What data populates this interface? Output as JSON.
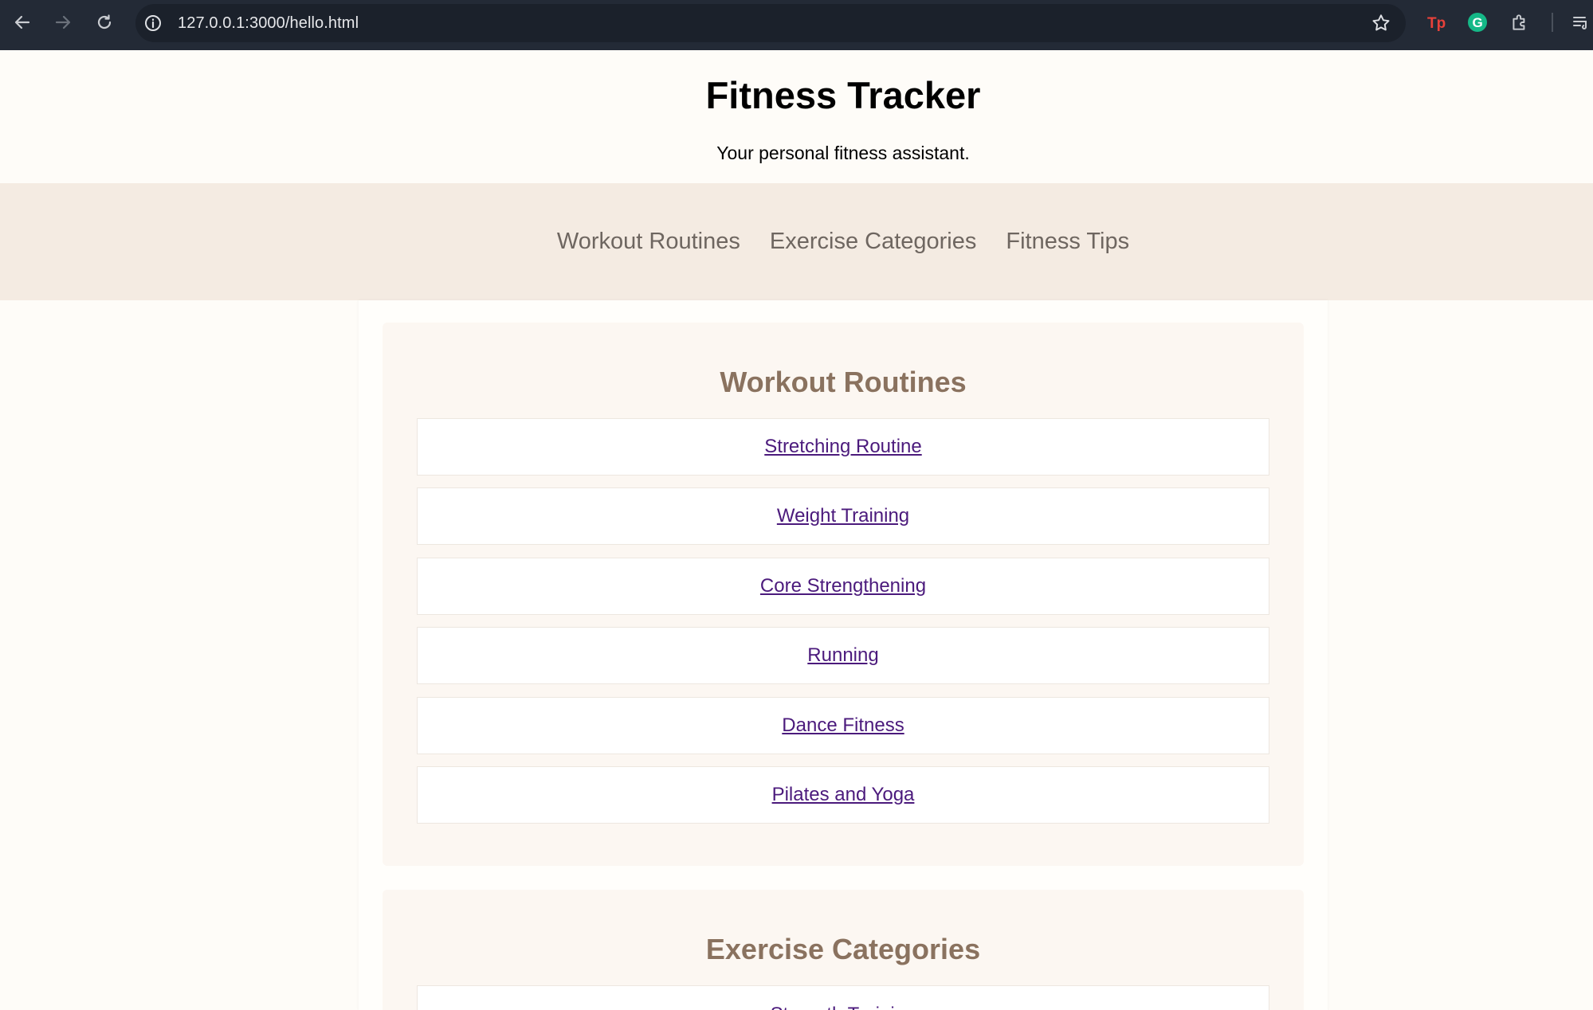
{
  "browser": {
    "url": "127.0.0.1:3000/hello.html"
  },
  "header": {
    "title": "Fitness Tracker",
    "subtitle": "Your personal fitness assistant."
  },
  "nav": {
    "items": [
      "Workout Routines",
      "Exercise Categories",
      "Fitness Tips"
    ]
  },
  "sections": [
    {
      "title": "Workout Routines",
      "items": [
        "Stretching Routine",
        "Weight Training",
        "Core Strengthening",
        "Running",
        "Dance Fitness",
        "Pilates and Yoga"
      ]
    },
    {
      "title": "Exercise Categories",
      "items": [
        "Strength Training"
      ]
    }
  ],
  "colors": {
    "page_bg": "#fefcf8",
    "nav_bg": "#f4ebe2",
    "section_bg": "#fcf7f2",
    "heading": "#8a725f",
    "link": "#4b1a7c"
  }
}
